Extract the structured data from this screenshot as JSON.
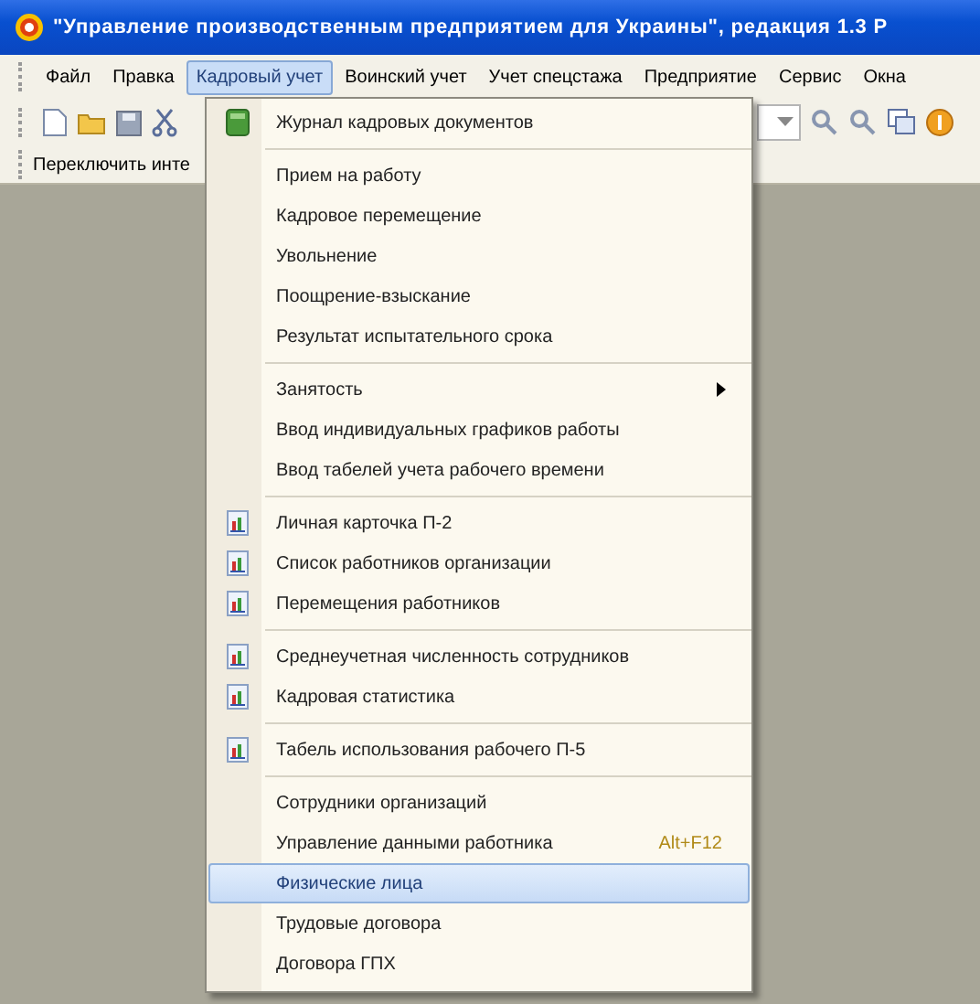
{
  "window": {
    "title": "\"Управление производственным предприятием для Украины\", редакция 1.3 Р"
  },
  "menubar": [
    {
      "label": "Файл",
      "selected": false
    },
    {
      "label": "Правка",
      "selected": false
    },
    {
      "label": "Кадровый учет",
      "selected": true
    },
    {
      "label": "Воинский учет",
      "selected": false
    },
    {
      "label": "Учет спецстажа",
      "selected": false
    },
    {
      "label": "Предприятие",
      "selected": false
    },
    {
      "label": "Сервис",
      "selected": false
    },
    {
      "label": "Окна",
      "selected": false
    }
  ],
  "switch_bar": {
    "label": "Переключить инте"
  },
  "menu": {
    "groups": [
      [
        {
          "label": "Журнал кадровых документов",
          "kind": "journal",
          "selected": false
        }
      ],
      [
        {
          "label": "Прием на работу",
          "selected": false
        },
        {
          "label": "Кадровое перемещение",
          "selected": false
        },
        {
          "label": "Увольнение",
          "selected": false
        },
        {
          "label": "Поощрение-взыскание",
          "selected": false
        },
        {
          "label": "Результат испытательного срока",
          "selected": false
        }
      ],
      [
        {
          "label": "Занятость",
          "submenu": true,
          "selected": false
        },
        {
          "label": "Ввод индивидуальных графиков работы",
          "selected": false
        },
        {
          "label": "Ввод табелей учета рабочего времени",
          "selected": false
        }
      ],
      [
        {
          "label": "Личная карточка П-2",
          "kind": "report",
          "selected": false
        },
        {
          "label": "Список работников организации",
          "kind": "report",
          "selected": false
        },
        {
          "label": "Перемещения работников",
          "kind": "report",
          "selected": false
        }
      ],
      [
        {
          "label": "Среднеучетная численность сотрудников",
          "kind": "report",
          "selected": false
        },
        {
          "label": "Кадровая статистика",
          "kind": "report",
          "selected": false
        }
      ],
      [
        {
          "label": "Табель использования рабочего П-5",
          "kind": "report",
          "selected": false
        }
      ],
      [
        {
          "label": "Сотрудники организаций",
          "selected": false
        },
        {
          "label": "Управление данными работника",
          "shortcut": "Alt+F12",
          "selected": false
        },
        {
          "label": "Физические лица",
          "selected": true
        },
        {
          "label": "Трудовые договора",
          "selected": false
        },
        {
          "label": "Договора ГПХ",
          "selected": false
        }
      ]
    ]
  }
}
